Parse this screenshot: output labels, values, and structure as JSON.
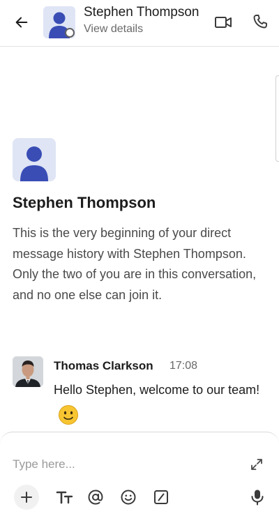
{
  "header": {
    "title": "Stephen Thompson",
    "subtitle": "View details"
  },
  "intro": {
    "name": "Stephen Thompson",
    "description": "This is the very beginning of your direct message history with Stephen Thompson. Only the two of you are in this conversation, and no one else can join it."
  },
  "messages": [
    {
      "sender": "Thomas Clarkson",
      "time": "17:08",
      "text": "Hello Stephen, welcome to our team!",
      "emoji": "slightly-smiling-face"
    }
  ],
  "composer": {
    "placeholder": "Type here...",
    "format_label": "Tт"
  },
  "icons": {
    "back": "arrow-left-icon",
    "video": "video-camera-icon",
    "call": "phone-icon",
    "expand": "expand-arrows-icon",
    "add": "plus-icon",
    "mention": "at-sign-icon",
    "emoji": "smiley-icon",
    "shortcut": "slash-box-icon",
    "mic": "microphone-icon"
  },
  "colors": {
    "avatar_bg": "#dfe5f5",
    "avatar_fg": "#3a4db5",
    "text_primary": "#1d1c1d",
    "text_secondary": "#696969",
    "emoji_yellow": "#f7c531"
  }
}
